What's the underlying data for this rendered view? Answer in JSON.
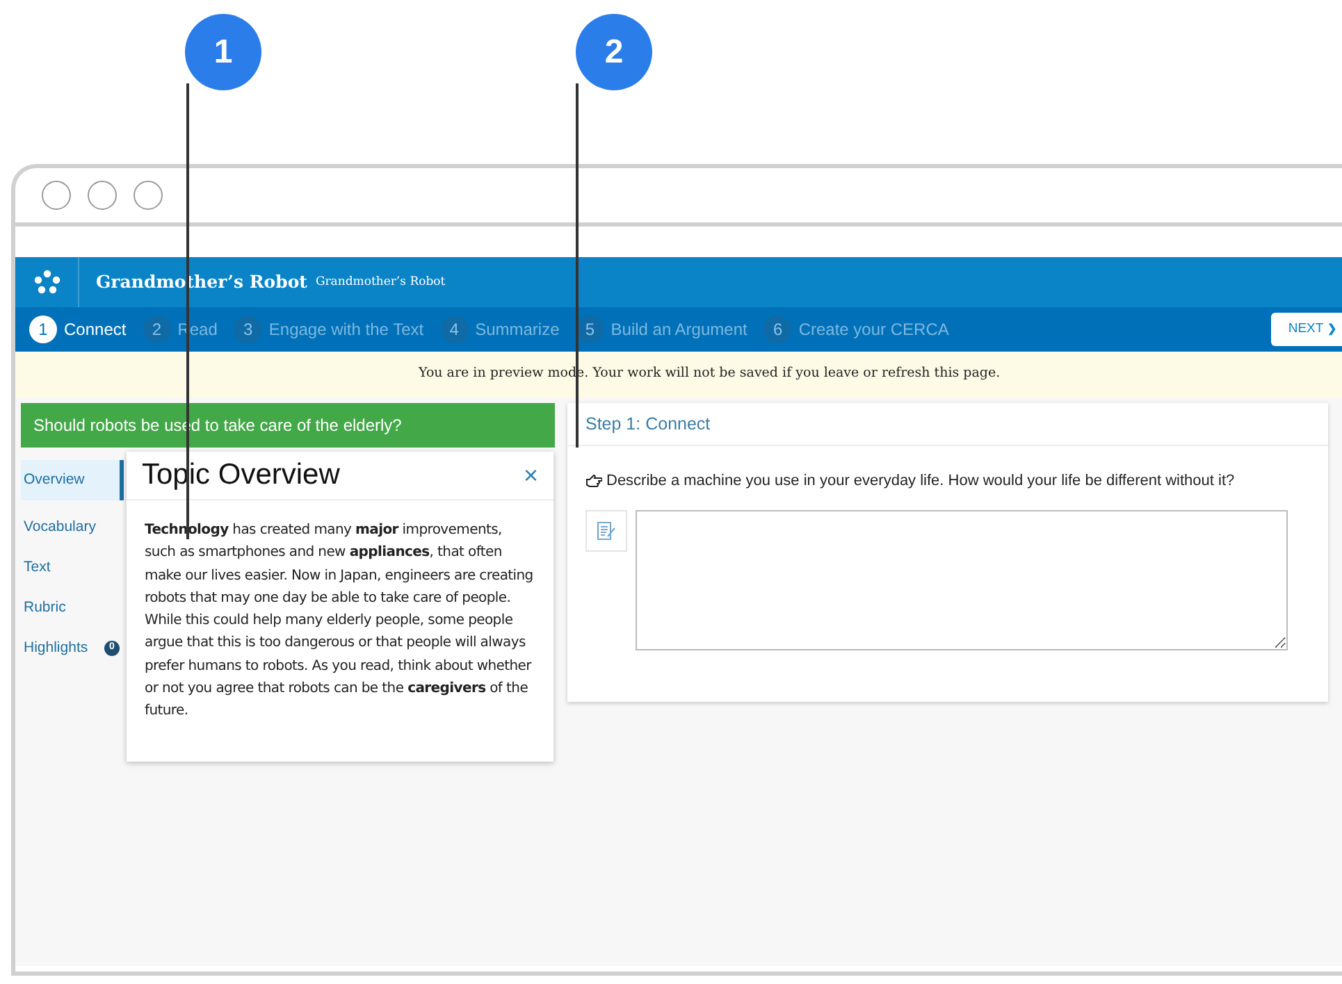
{
  "callouts": [
    {
      "label": "1"
    },
    {
      "label": "2"
    }
  ],
  "app": {
    "title": "Grandmother’s Robot",
    "subtitle": "Grandmother’s Robot"
  },
  "steps": [
    {
      "number": "1",
      "label": "Connect",
      "selected": true
    },
    {
      "number": "2",
      "label": "Read",
      "selected": false
    },
    {
      "number": "3",
      "label": "Engage with the Text",
      "selected": false
    },
    {
      "number": "4",
      "label": "Summarize",
      "selected": false
    },
    {
      "number": "5",
      "label": "Build an Argument",
      "selected": false
    },
    {
      "number": "6",
      "label": "Create your CERCA",
      "selected": false
    }
  ],
  "next_button": "NEXT",
  "next_glyph": "❯",
  "banner": "You are in preview mode. Your work will not be saved if you leave or refresh this page.",
  "question": "Should robots be used to take care of the elderly?",
  "sidebar": {
    "items": [
      {
        "label": "Overview",
        "selected": true
      },
      {
        "label": "Vocabulary",
        "selected": false
      },
      {
        "label": "Text",
        "selected": false
      },
      {
        "label": "Rubric",
        "selected": false
      },
      {
        "label": "Highlights",
        "selected": false,
        "badge": "0"
      }
    ]
  },
  "popup": {
    "title": "Topic Overview",
    "close": "×",
    "body": "**Technology** has created many **major** improvements, such as smartphones and new **appliances**, that often make our lives easier. Now in Japan, engineers are creating robots that may one day be able to take care of people. While this could help many elderly people, some people argue that this is too dangerous or that people will always prefer humans to robots. As you read, think about whether or not you agree that robots can be the **caregivers** of the future."
  },
  "step_card": {
    "title": "Step 1: Connect",
    "prompt": "Describe a machine you use in your everyday life. How would your life be different without it?"
  }
}
